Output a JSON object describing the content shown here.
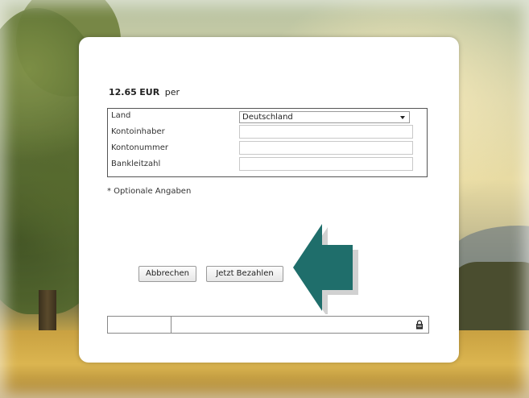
{
  "payment": {
    "amount": "12.65",
    "currency": "EUR",
    "per": "per"
  },
  "form": {
    "country_label": "Land",
    "country_value": "Deutschland",
    "holder_label": "Kontoinhaber",
    "holder_value": "",
    "account_label": "Kontonummer",
    "account_value": "",
    "bank_code_label": "Bankleitzahl",
    "bank_code_value": ""
  },
  "note": "* Optionale Angaben",
  "buttons": {
    "cancel_label": "Abbrechen",
    "pay_label": "Jetzt Bezahlen"
  },
  "icons": {
    "country_dropdown": "chevron-down-icon",
    "pointer_arrow": "arrow-left-icon",
    "secure": "lock-icon"
  },
  "colors": {
    "arrow": "#1f6e6b",
    "dialog_background": "#ffffff"
  }
}
